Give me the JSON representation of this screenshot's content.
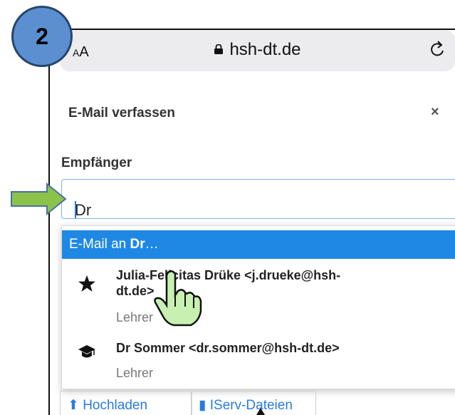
{
  "badge": {
    "number": "2"
  },
  "browser": {
    "text_size_label_small": "A",
    "text_size_label_large": "A",
    "domain": "hsh-dt.de"
  },
  "dialog": {
    "title": "E-Mail verfassen",
    "close_label": "×"
  },
  "recipient": {
    "label": "Empfänger",
    "value": "Dr"
  },
  "suggestions": {
    "header_prefix": "E-Mail an ",
    "header_query": "Dr",
    "header_suffix": "…",
    "items": [
      {
        "name_line1": "Julia-Felicitas Drüke <j.drueke@hsh-",
        "name_line2": "dt.de>",
        "role": "Lehrer",
        "icon": "star-icon"
      },
      {
        "name_line1": "Dr Sommer <dr.sommer@hsh-dt.de>",
        "role": "Lehrer",
        "icon": "graduation-cap-icon"
      }
    ]
  },
  "actions": {
    "upload_label": "Hochladen",
    "iserv_files_label": "IServ-Dateien"
  },
  "colors": {
    "accent": "#1f88e5",
    "badge": "#5b8fd0",
    "arrow": "#8bc34a"
  }
}
